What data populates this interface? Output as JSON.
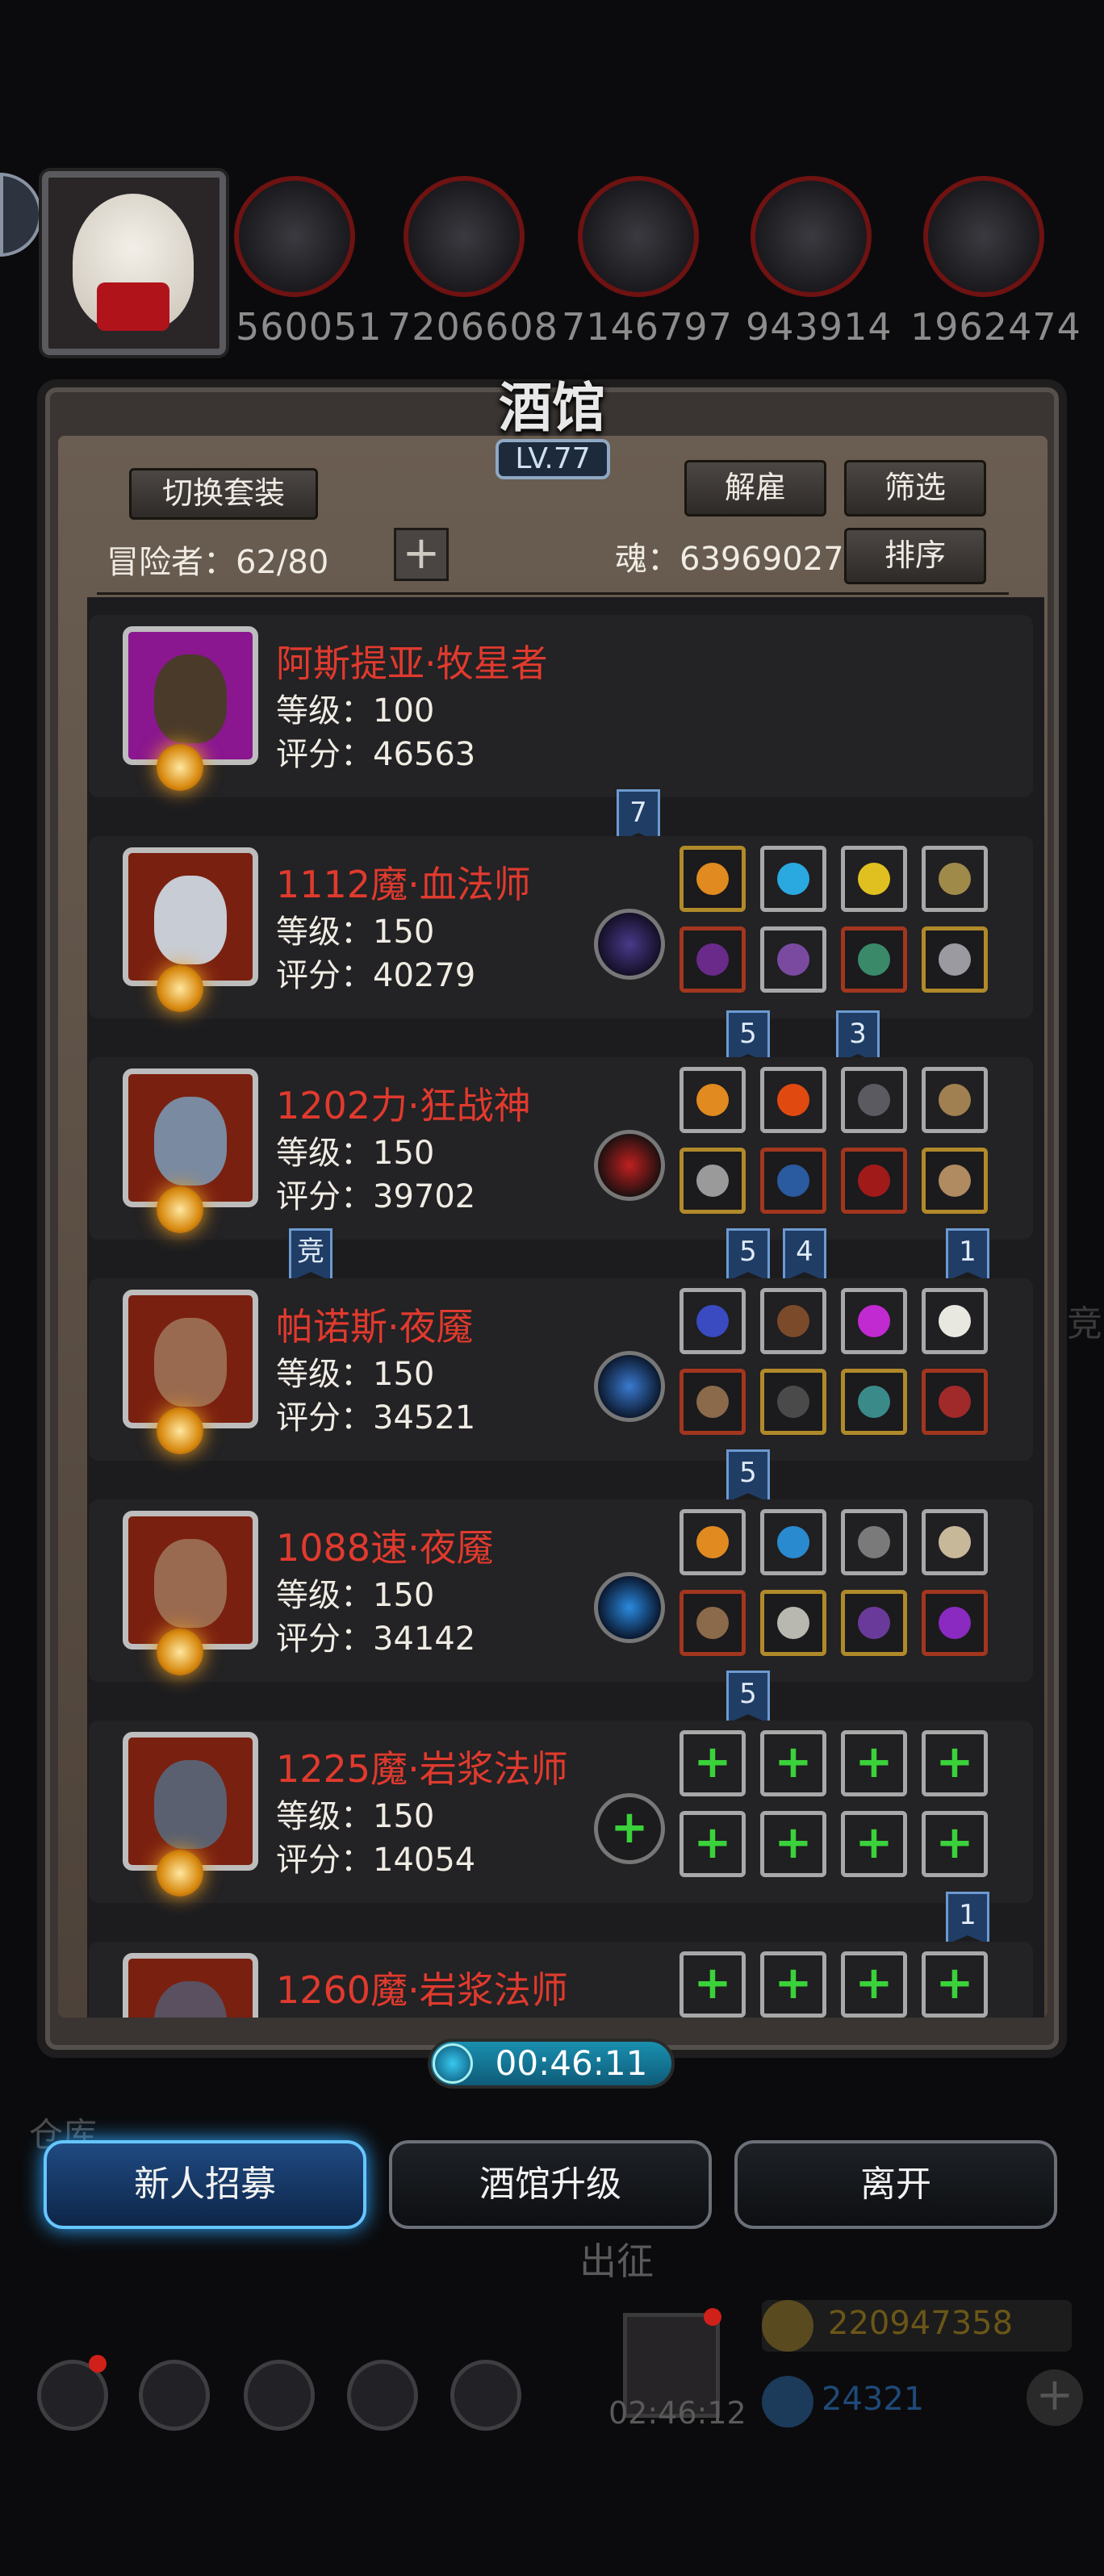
{
  "top": {
    "resources": [
      "560051",
      "7206608",
      "7146797",
      "943914",
      "1962474"
    ]
  },
  "tavern": {
    "title": "酒馆",
    "level": "LV.77",
    "switch_set_label": "切换套装",
    "dismiss_label": "解雇",
    "filter_label": "筛选",
    "sort_label": "排序",
    "adventurers_label": "冒险者：62/80",
    "soul_label": "魂：63969027",
    "add_label": "+"
  },
  "heroes": [
    {
      "name": "阿斯提亚·牧星者",
      "level": "等级：100",
      "score": "评分：46563",
      "frame": "purple",
      "has_gear": false
    },
    {
      "name": "1112魔·血法师",
      "level": "等级：150",
      "score": "评分：40279",
      "frame": "red",
      "has_gear": true
    },
    {
      "name": "1202力·狂战神",
      "level": "等级：150",
      "score": "评分：39702",
      "frame": "red",
      "has_gear": true
    },
    {
      "name": "帕诺斯·夜魇",
      "level": "等级：150",
      "score": "评分：34521",
      "frame": "red",
      "has_gear": true
    },
    {
      "name": "1088速·夜魇",
      "level": "等级：150",
      "score": "评分：34142",
      "frame": "red",
      "has_gear": true
    },
    {
      "name": "1225魔·岩浆法师",
      "level": "等级：150",
      "score": "评分：14054",
      "frame": "red",
      "has_gear": false
    },
    {
      "name": "1260魔·岩浆法师",
      "level": "",
      "score": "",
      "frame": "red",
      "has_gear": false
    }
  ],
  "tags": {
    "t1": "7",
    "t2": "5",
    "t3": "3",
    "t4": "竞",
    "t5": "5",
    "t6": "4",
    "t7": "1",
    "t8": "5",
    "t9": "5",
    "t10": "1"
  },
  "timer": "00:46:11",
  "bottom_buttons": {
    "recruit": "新人招募",
    "upgrade": "酒馆升级",
    "leave": "离开"
  },
  "background": {
    "warehouse": "仓库",
    "expedition": "出征",
    "gift_timer": "02:46:12",
    "gold": "220947358",
    "gems": "24321",
    "side_char": "竞"
  },
  "colors": {
    "hero_name": "#e03a2e",
    "recruit_glow": "#2fa6ff",
    "timer_bar": "#1a8fb0"
  }
}
